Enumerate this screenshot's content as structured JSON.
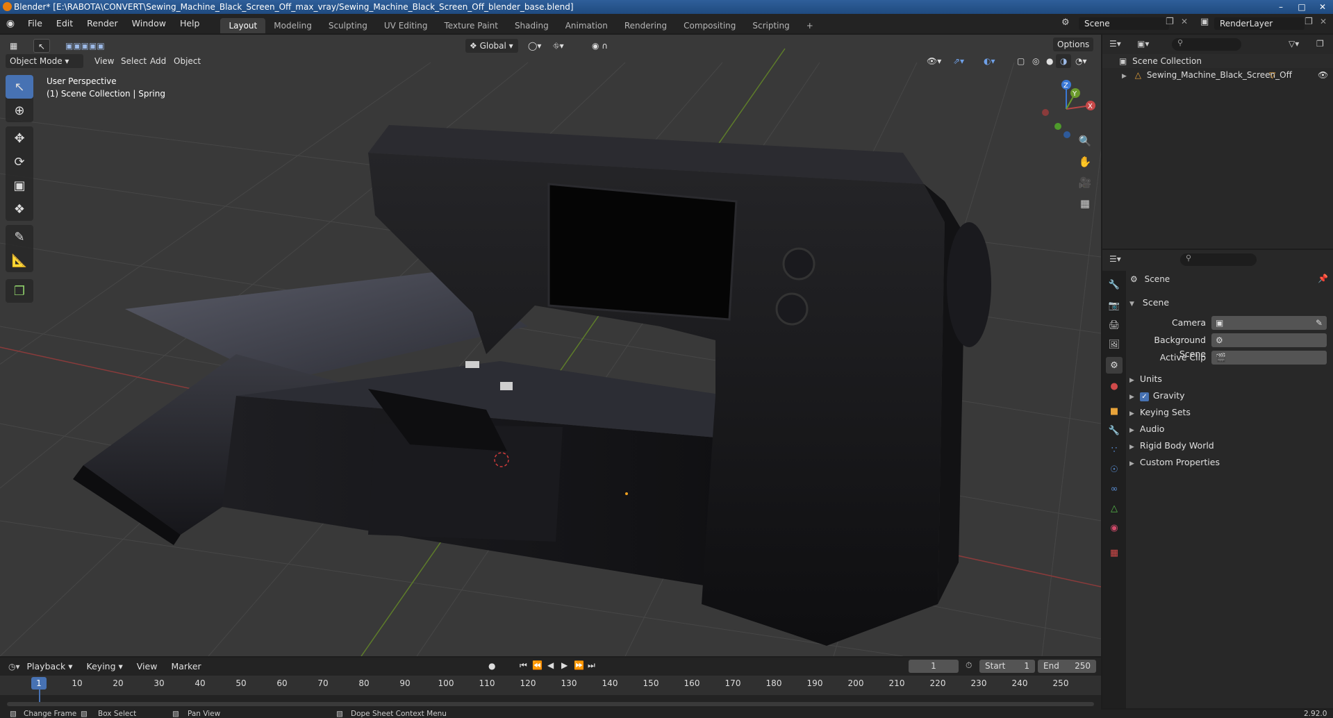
{
  "window": {
    "title": "Blender* [E:\\RABOTA\\CONVERT\\Sewing_Machine_Black_Screen_Off_max_vray/Sewing_Machine_Black_Screen_Off_blender_base.blend]",
    "controls": [
      "–",
      "□",
      "✕"
    ]
  },
  "menubar": {
    "items": [
      "File",
      "Edit",
      "Render",
      "Window",
      "Help"
    ],
    "workspaces": [
      "Layout",
      "Modeling",
      "Sculpting",
      "UV Editing",
      "Texture Paint",
      "Shading",
      "Animation",
      "Rendering",
      "Compositing",
      "Scripting"
    ],
    "active_workspace": "Layout",
    "add_tab": "+",
    "scene": "Scene",
    "view_layer": "RenderLayer"
  },
  "viewport": {
    "mode": "Object Mode",
    "menus": [
      "View",
      "Select",
      "Add",
      "Object"
    ],
    "orientation": "Global",
    "options": "Options",
    "overlay_title": "User Perspective",
    "overlay_subtitle": "(1) Scene Collection | Spring",
    "gizmo_axes": {
      "x": "X",
      "y": "Y",
      "z": "Z"
    }
  },
  "outliner": {
    "root": "Scene Collection",
    "items": [
      {
        "label": "Sewing_Machine_Black_Screen_Off"
      }
    ]
  },
  "properties": {
    "context": "Scene",
    "section": "Scene",
    "fields": [
      {
        "label": "Camera"
      },
      {
        "label": "Background Scene"
      },
      {
        "label": "Active Clip"
      }
    ],
    "panels": [
      {
        "label": "Units",
        "checkbox": false
      },
      {
        "label": "Gravity",
        "checkbox": true
      },
      {
        "label": "Keying Sets",
        "checkbox": false
      },
      {
        "label": "Audio",
        "checkbox": false
      },
      {
        "label": "Rigid Body World",
        "checkbox": false
      },
      {
        "label": "Custom Properties",
        "checkbox": false
      }
    ]
  },
  "timeline": {
    "menus": [
      "Playback",
      "Keying",
      "View",
      "Marker"
    ],
    "current_frame": "1",
    "start_label": "Start",
    "start": "1",
    "end_label": "End",
    "end": "250",
    "ruler": [
      "10",
      "20",
      "30",
      "40",
      "50",
      "60",
      "70",
      "80",
      "90",
      "100",
      "110",
      "120",
      "130",
      "140",
      "150",
      "160",
      "170",
      "180",
      "190",
      "200",
      "210",
      "220",
      "230",
      "240",
      "250"
    ],
    "playhead": "1"
  },
  "statusbar": {
    "items": [
      "Change Frame",
      "Box Select",
      "Pan View",
      "Dope Sheet Context Menu"
    ],
    "version": "2.92.0"
  },
  "colors": {
    "accent": "#4772b3",
    "x_axis": "#a34848",
    "y_axis": "#6a8e2b",
    "z_axis": "#3a78d6"
  }
}
